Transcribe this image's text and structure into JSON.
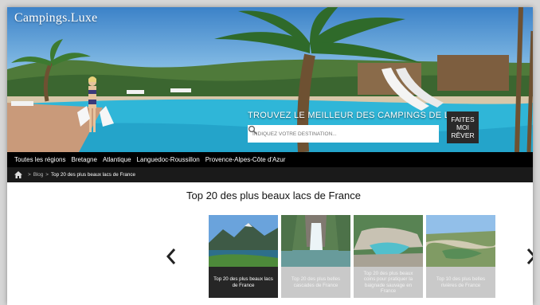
{
  "brand": {
    "name": "Campings.Luxe"
  },
  "search": {
    "title": "Trouvez le meilleur des campings de luxe",
    "placeholder": "Indiquez votre destination...",
    "icon": "search-icon",
    "dream_button": "FAITES MOI RÊVER"
  },
  "nav": {
    "items": [
      "Toutes les régions",
      "Bretagne",
      "Atlantique",
      "Languedoc-Roussillon",
      "Provence-Alpes-Côte d'Azur"
    ]
  },
  "breadcrumb": {
    "home_icon": "home-icon",
    "items": [
      "Blog",
      "Top 20 des plus beaux lacs de France"
    ]
  },
  "main": {
    "title": "Top 20 des plus beaux lacs de France",
    "cards": [
      {
        "caption": "Top 20 des plus beaux lacs de France",
        "state": "active"
      },
      {
        "caption": "Top 20 des plus belles cascades de France",
        "state": "dim"
      },
      {
        "caption": "Top 20 des plus beaux coins pour pratiquer la baignade sauvage en France",
        "state": "dim"
      },
      {
        "caption": "Top 10 des plus belles rivières de France",
        "state": "dim"
      }
    ]
  },
  "colors": {
    "nav_bg": "#000000",
    "crumb_bg": "#1a1a1a",
    "active_card": "#262626",
    "dim_card": "#c9c9c9"
  }
}
